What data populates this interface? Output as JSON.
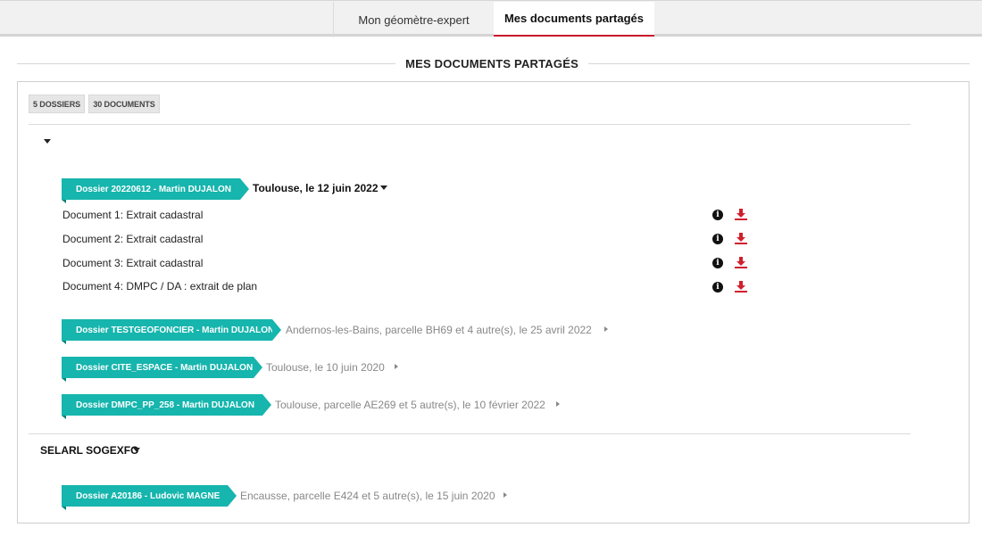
{
  "tabs": [
    {
      "label": "Mon géomètre-expert",
      "active": false
    },
    {
      "label": "Mes documents partagés",
      "active": true
    }
  ],
  "page_title": "MES DOCUMENTS PARTAGÉS",
  "summary": {
    "folders_label": "5 DOSSIERS",
    "documents_label": "30 DOCUMENTS"
  },
  "groups": [
    {
      "name": "",
      "expanded": true,
      "folders": [
        {
          "label": "Dossier 20220612 - Martin DUJALON",
          "description": "Toulouse, le 12 juin 2022",
          "expanded": true,
          "documents": [
            {
              "name": "Document 1: Extrait cadastral"
            },
            {
              "name": "Document 2: Extrait cadastral"
            },
            {
              "name": "Document 3: Extrait cadastral"
            },
            {
              "name": "Document 4: DMPC / DA : extrait de plan"
            }
          ]
        },
        {
          "label": "Dossier TESTGEOFONCIER - Martin DUJALON",
          "description": "Andernos-les-Bains, parcelle BH69 et 4 autre(s), le 25 avril 2022",
          "expanded": false
        },
        {
          "label": "Dossier CITE_ESPACE - Martin DUJALON",
          "description": "Toulouse, le 10 juin 2020",
          "expanded": false
        },
        {
          "label": "Dossier DMPC_PP_258 - Martin DUJALON",
          "description": "Toulouse, parcelle AE269 et 5 autre(s), le 10 février 2022",
          "expanded": false
        }
      ]
    },
    {
      "name": "SELARL SOGEXFO",
      "expanded": true,
      "folders": [
        {
          "label": "Dossier A20186 - Ludovic MAGNE",
          "description": "Encausse, parcelle E424 et 5 autre(s), le 15 juin 2020",
          "expanded": false
        }
      ]
    }
  ],
  "icons": {
    "info": "info-circle-icon",
    "download": "download-icon",
    "info_glyph": "i"
  },
  "colors": {
    "accent_teal": "#16b5ad",
    "active_tab_underline": "#c7172b",
    "download_red": "#d0202e"
  }
}
